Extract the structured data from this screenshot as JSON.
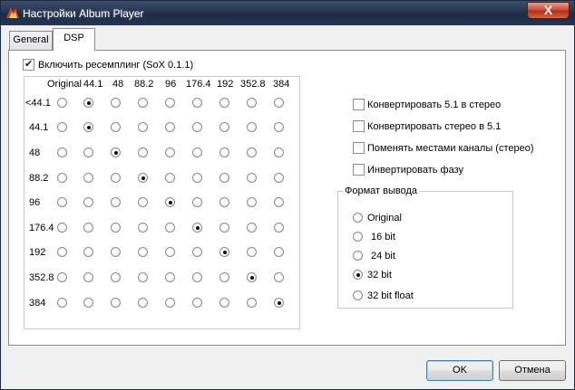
{
  "window": {
    "title": "Настройки Album Player",
    "close_label": "X",
    "icon": "app-flame-icon"
  },
  "tabs": [
    {
      "label": "General",
      "active": false
    },
    {
      "label": "DSP",
      "active": true
    }
  ],
  "resample": {
    "label": "Включить ресемплинг  (SoX 0.1.1)",
    "checked": true
  },
  "matrix": {
    "columns": [
      "Original",
      "44.1",
      "48",
      "88.2",
      "96",
      "176.4",
      "192",
      "352.8",
      "384"
    ],
    "rows": [
      "<44.1",
      "44.1",
      "48",
      "88.2",
      "96",
      "176.4",
      "192",
      "352.8",
      "384"
    ],
    "selected": [
      1,
      1,
      2,
      3,
      4,
      5,
      6,
      7,
      8
    ]
  },
  "options": [
    {
      "label": "Конвертировать 5.1 в стерео",
      "checked": false
    },
    {
      "label": "Конвертировать стерео в 5.1",
      "checked": false
    },
    {
      "label": "Поменять местами каналы (стерео)",
      "checked": false
    },
    {
      "label": "Инвертировать фазу",
      "checked": false
    }
  ],
  "output_format": {
    "title": "Формат вывода",
    "items": [
      "Original",
      "16 bit",
      "24 bit",
      "32 bit",
      "32 bit float"
    ],
    "selected": 3
  },
  "buttons": {
    "ok": "OK",
    "cancel": "Отмена"
  }
}
